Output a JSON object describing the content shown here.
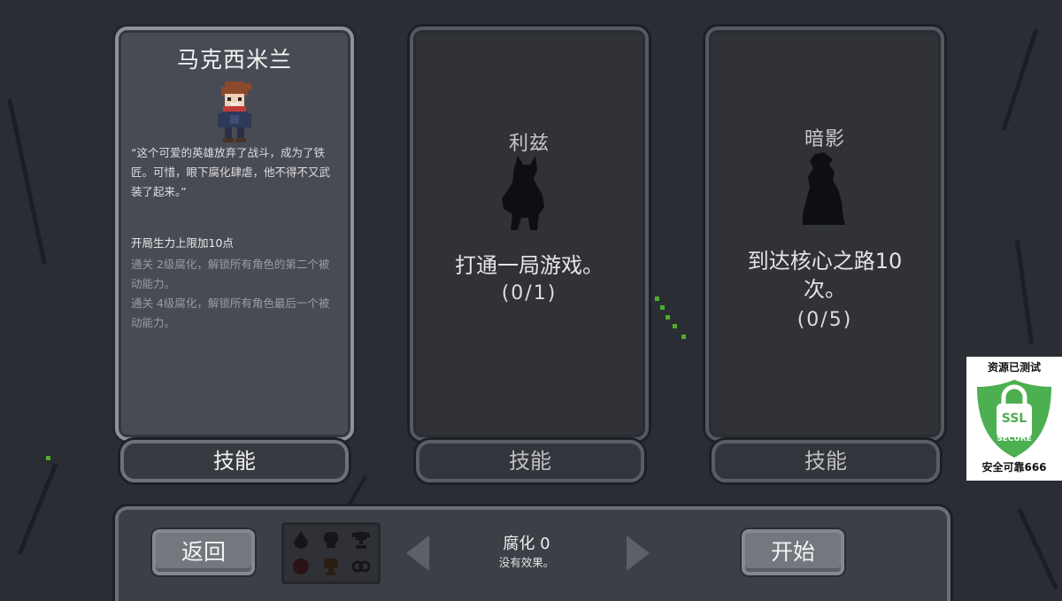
{
  "characters": [
    {
      "name": "马克西米兰",
      "description": "“这个可爱的英雄放弃了战斗，成为了铁匠。可惜，眼下腐化肆虐，他不得不又武装了起来。”",
      "stats": [
        "开局生力上限加10点",
        "通关 2级腐化，解锁所有角色的第二个被动能力。",
        "通关 4级腐化，解锁所有角色最后一个被动能力。"
      ],
      "skill_label": "技能"
    },
    {
      "name": "利兹",
      "requirement": "打通一局游戏。",
      "progress": "(0/1)",
      "skill_label": "技能"
    },
    {
      "name": "暗影",
      "requirement": "到达核心之路10次。",
      "progress": "(0/5)",
      "skill_label": "技能"
    }
  ],
  "bottom_bar": {
    "back_label": "返回",
    "start_label": "开始",
    "corruption_title": "腐化 0",
    "corruption_desc": "没有效果。",
    "icons": [
      "drop-icon",
      "skull-icon",
      "trophy-icon",
      "orb-icon",
      "shield-icon",
      "infinity-icon"
    ]
  },
  "ssl_badge": {
    "top_text": "资源已测试",
    "shield_line1": "SSL",
    "shield_line2": "SECURE",
    "bottom_text": "安全可靠666"
  },
  "colors": {
    "background": "#2b2d34",
    "card_selected": "#494b54",
    "card_locked": "#303238",
    "vine": "#4caf2a",
    "ssl_green": "#4caf50"
  }
}
